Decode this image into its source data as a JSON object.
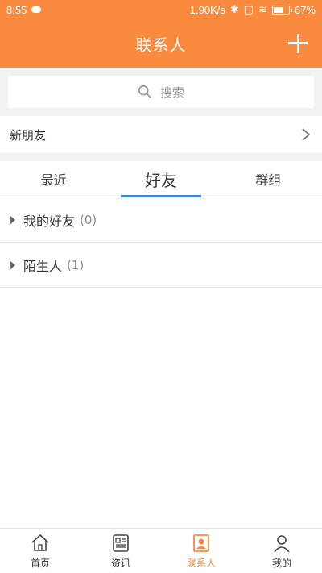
{
  "status_bar": {
    "time": "8:55",
    "network_speed": "1.90K/s",
    "battery": "67%"
  },
  "header": {
    "title": "联系人",
    "add_icon": "plus-icon"
  },
  "search": {
    "placeholder": "搜索"
  },
  "new_friends": {
    "label": "新朋友"
  },
  "tabs": [
    {
      "label": "最近",
      "active": false
    },
    {
      "label": "好友",
      "active": true
    },
    {
      "label": "群组",
      "active": false
    }
  ],
  "groups": [
    {
      "name": "我的好友",
      "count": "(0)"
    },
    {
      "name": "陌生人",
      "count": "(1)"
    }
  ],
  "bottom_nav": [
    {
      "label": "首页",
      "icon": "home-icon"
    },
    {
      "label": "资讯",
      "icon": "news-icon"
    },
    {
      "label": "联系人",
      "icon": "contacts-icon",
      "active": true
    },
    {
      "label": "我的",
      "icon": "profile-icon"
    }
  ],
  "colors": {
    "accent": "#f98a3e",
    "tab_indicator": "#3f86d6"
  }
}
